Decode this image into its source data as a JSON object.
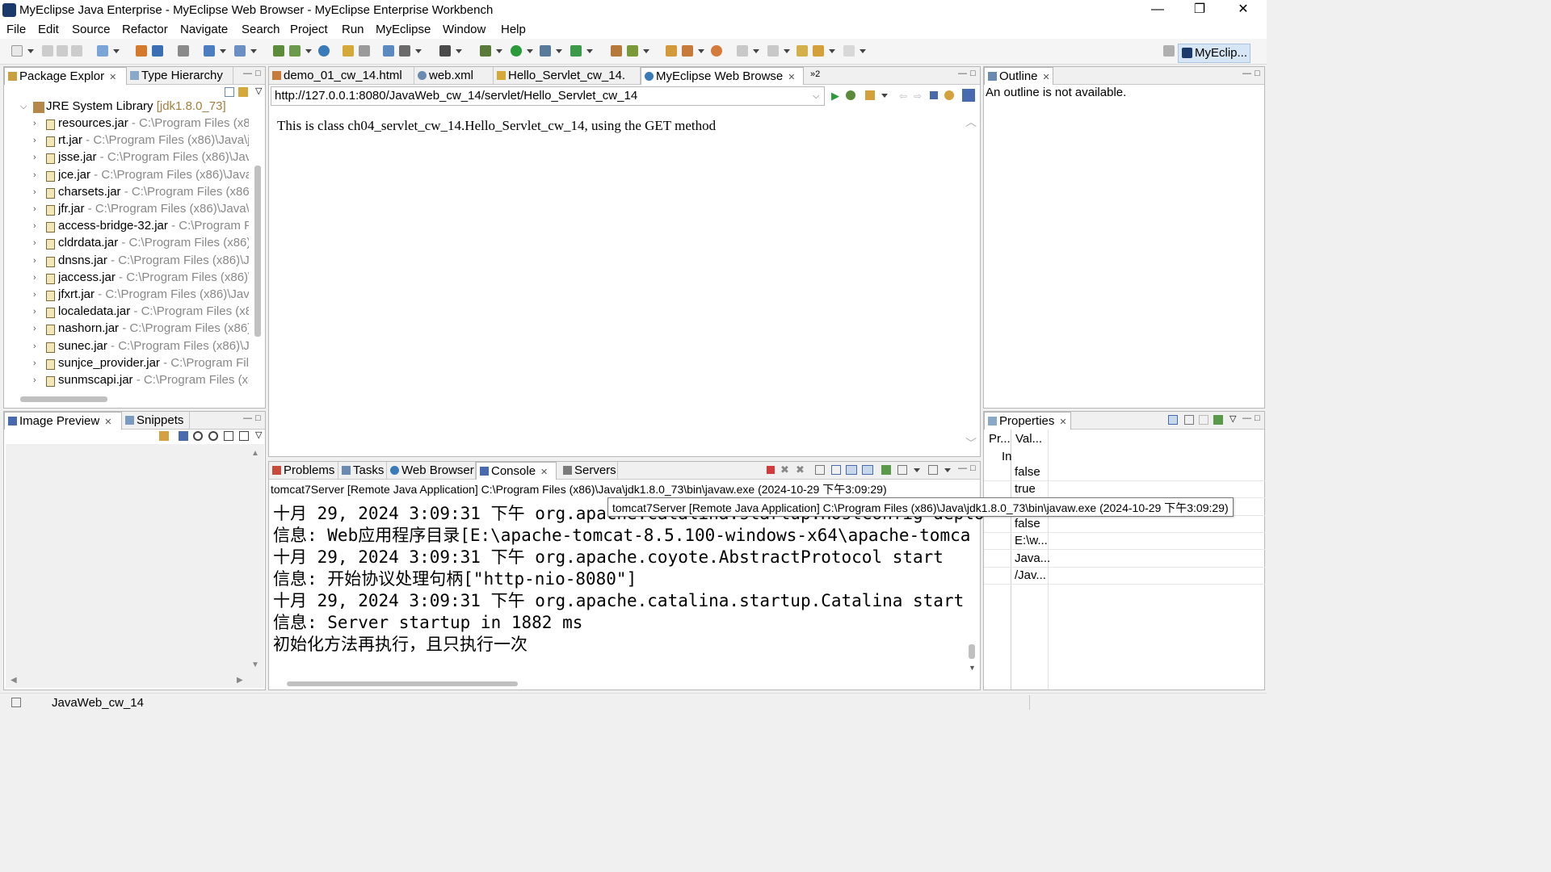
{
  "window": {
    "title": "MyEclipse Java Enterprise - MyEclipse Web Browser - MyEclipse Enterprise Workbench",
    "minimize": "—",
    "restore": "❐",
    "close": "✕"
  },
  "menu": [
    "File",
    "Edit",
    "Source",
    "Refactor",
    "Navigate",
    "Search",
    "Project",
    "Run",
    "MyEclipse",
    "Window",
    "Help"
  ],
  "perspective": {
    "label": "MyEclip..."
  },
  "package_explorer": {
    "tabs": [
      "Package Explor",
      "Type Hierarchy"
    ],
    "root": {
      "label": "JRE System Library",
      "detail": "[jdk1.8.0_73]"
    },
    "items": [
      {
        "name": "resources.jar",
        "path": " - C:\\Program Files (x86"
      },
      {
        "name": "rt.jar",
        "path": " - C:\\Program Files (x86)\\Java\\jc"
      },
      {
        "name": "jsse.jar",
        "path": " - C:\\Program Files (x86)\\Java"
      },
      {
        "name": "jce.jar",
        "path": " - C:\\Program Files (x86)\\Java\\"
      },
      {
        "name": "charsets.jar",
        "path": " - C:\\Program Files (x86)\\"
      },
      {
        "name": "jfr.jar",
        "path": " - C:\\Program Files (x86)\\Java\\j"
      },
      {
        "name": "access-bridge-32.jar",
        "path": " - C:\\Program F"
      },
      {
        "name": "cldrdata.jar",
        "path": " - C:\\Program Files (x86)\\"
      },
      {
        "name": "dnsns.jar",
        "path": " - C:\\Program Files (x86)\\Ja"
      },
      {
        "name": "jaccess.jar",
        "path": " - C:\\Program Files (x86)\\."
      },
      {
        "name": "jfxrt.jar",
        "path": " - C:\\Program Files (x86)\\Java"
      },
      {
        "name": "localedata.jar",
        "path": " - C:\\Program Files (x8"
      },
      {
        "name": "nashorn.jar",
        "path": " - C:\\Program Files (x86)\\"
      },
      {
        "name": "sunec.jar",
        "path": " - C:\\Program Files (x86)\\Ja"
      },
      {
        "name": "sunjce_provider.jar",
        "path": " - C:\\Program File"
      },
      {
        "name": "sunmscapi.jar",
        "path": " - C:\\Program Files (x8"
      }
    ]
  },
  "image_preview": {
    "tabs": [
      "Image Preview",
      "Snippets"
    ]
  },
  "editor": {
    "tabs": [
      "demo_01_cw_14.html",
      "web.xml",
      "Hello_Servlet_cw_14.",
      "MyEclipse Web Browse"
    ],
    "overflow": "»2",
    "url": "http://127.0.0.1:8080/JavaWeb_cw_14/servlet/Hello_Servlet_cw_14",
    "content": "This is class ch04_servlet_cw_14.Hello_Servlet_cw_14, using the GET method"
  },
  "console": {
    "tabs": [
      "Problems",
      "Tasks",
      "Web Browser",
      "Console",
      "Servers"
    ],
    "header": "tomcat7Server [Remote Java Application] C:\\Program Files (x86)\\Java\\jdk1.8.0_73\\bin\\javaw.exe (2024-10-29 下午3:09:29)",
    "tooltip": "tomcat7Server [Remote Java Application] C:\\Program Files (x86)\\Java\\jdk1.8.0_73\\bin\\javaw.exe (2024-10-29 下午3:09:29)",
    "lines": [
      "十月 29, 2024 3:09:31 下午 org.apache.catalina.startup.HostConfig deploy",
      "信息: Web应用程序目录[E:\\apache-tomcat-8.5.100-windows-x64\\apache-tomca",
      "十月 29, 2024 3:09:31 下午 org.apache.coyote.AbstractProtocol start",
      "信息: 开始协议处理句柄[\"http-nio-8080\"]",
      "十月 29, 2024 3:09:31 下午 org.apache.catalina.startup.Catalina start",
      "信息: Server startup in 1882 ms",
      "初始化方法再执行，且只执行一次"
    ]
  },
  "outline": {
    "tab": "Outline",
    "message": "An outline is not available."
  },
  "properties": {
    "tab": "Properties",
    "col_property": "Pr...",
    "col_value": "Val...",
    "group": "In",
    "values": [
      "false",
      "true",
      "",
      "false",
      "E:\\w...",
      "Java...",
      "/Jav..."
    ]
  },
  "statusbar": {
    "text": "JavaWeb_cw_14"
  }
}
